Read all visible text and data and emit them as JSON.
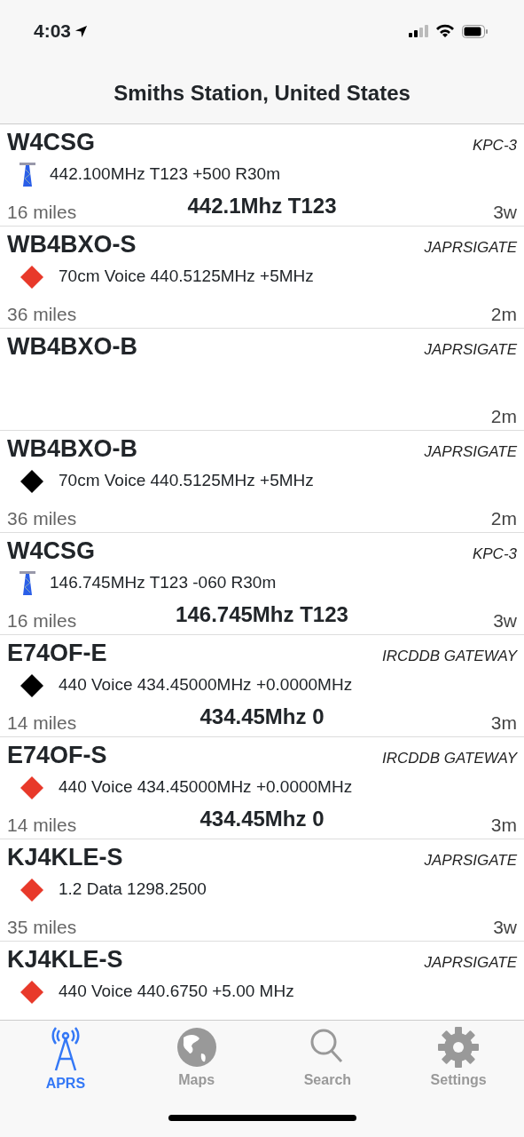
{
  "status_bar": {
    "time": "4:03"
  },
  "nav": {
    "title": "Smiths Station, United States"
  },
  "stations": [
    {
      "callsign": "W4CSG",
      "type": "KPC-3",
      "kind": "repeater",
      "detail": "442.100MHz T123 +500 R30m",
      "distance": "16 miles",
      "frequency": "442.1Mhz T123",
      "age": "3w"
    },
    {
      "callsign": "WB4BXO-S",
      "type": "JAPRSIGATE",
      "kind": "diamond",
      "color": "#e8392a",
      "detail": "70cm Voice 440.5125MHz +5MHz",
      "distance": "36 miles",
      "age": "2m"
    },
    {
      "callsign": "WB4BXO-B",
      "type": "JAPRSIGATE",
      "age": "2m"
    },
    {
      "callsign": "WB4BXO-B",
      "type": "JAPRSIGATE",
      "kind": "diamond",
      "color": "#000000",
      "detail": "70cm Voice 440.5125MHz +5MHz",
      "distance": "36 miles",
      "age": "2m"
    },
    {
      "callsign": "W4CSG",
      "type": "KPC-3",
      "kind": "repeater",
      "detail": "146.745MHz T123 -060 R30m",
      "distance": "16 miles",
      "frequency": "146.745Mhz T123",
      "age": "3w"
    },
    {
      "callsign": "E74OF-E",
      "type": "IRCDDB GATEWAY",
      "kind": "diamond",
      "color": "#000000",
      "detail": "440 Voice 434.45000MHz +0.0000MHz",
      "distance": "14 miles",
      "frequency": "434.45Mhz 0",
      "age": "3m"
    },
    {
      "callsign": "E74OF-S",
      "type": "IRCDDB GATEWAY",
      "kind": "diamond",
      "color": "#e8392a",
      "detail": "440 Voice 434.45000MHz +0.0000MHz",
      "distance": "14 miles",
      "frequency": "434.45Mhz 0",
      "age": "3m"
    },
    {
      "callsign": "KJ4KLE-S",
      "type": "JAPRSIGATE",
      "kind": "diamond",
      "color": "#e8392a",
      "detail": "1.2 Data 1298.2500",
      "distance": "35 miles",
      "age": "3w"
    },
    {
      "callsign": "KJ4KLE-S",
      "type": "JAPRSIGATE",
      "kind": "diamond",
      "color": "#e8392a",
      "detail": "440 Voice 440.6750 +5.00 MHz"
    }
  ],
  "tabs": [
    {
      "label": "APRS",
      "selected": true
    },
    {
      "label": "Maps",
      "selected": false
    },
    {
      "label": "Search",
      "selected": false
    },
    {
      "label": "Settings",
      "selected": false
    }
  ]
}
